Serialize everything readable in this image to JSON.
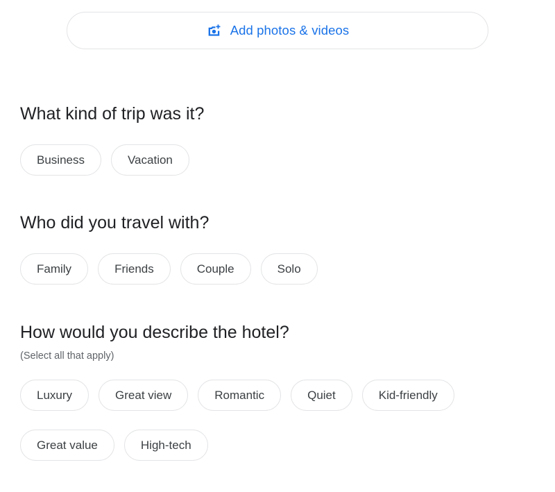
{
  "add_media": {
    "label": "Add photos & videos",
    "icon": "add-photo-camera-icon",
    "accent_color": "#1a73e8"
  },
  "sections": [
    {
      "id": "trip-type",
      "title": "What kind of trip was it?",
      "subtitle": "",
      "rows": [
        [
          "Business",
          "Vacation"
        ]
      ]
    },
    {
      "id": "travel-with",
      "title": "Who did you travel with?",
      "subtitle": "",
      "rows": [
        [
          "Family",
          "Friends",
          "Couple",
          "Solo"
        ]
      ]
    },
    {
      "id": "describe",
      "title": "How would you describe the hotel?",
      "subtitle": "(Select all that apply)",
      "rows": [
        [
          "Luxury",
          "Great view",
          "Romantic",
          "Quiet",
          "Kid-friendly"
        ],
        [
          "Great value",
          "High-tech"
        ]
      ]
    }
  ],
  "colors": {
    "background": "#ffffff",
    "chip_border": "#e3e4e6",
    "chip_text": "#3c4043",
    "title_text": "#202124",
    "subtitle_text": "#5f6368",
    "accent": "#1a73e8"
  }
}
